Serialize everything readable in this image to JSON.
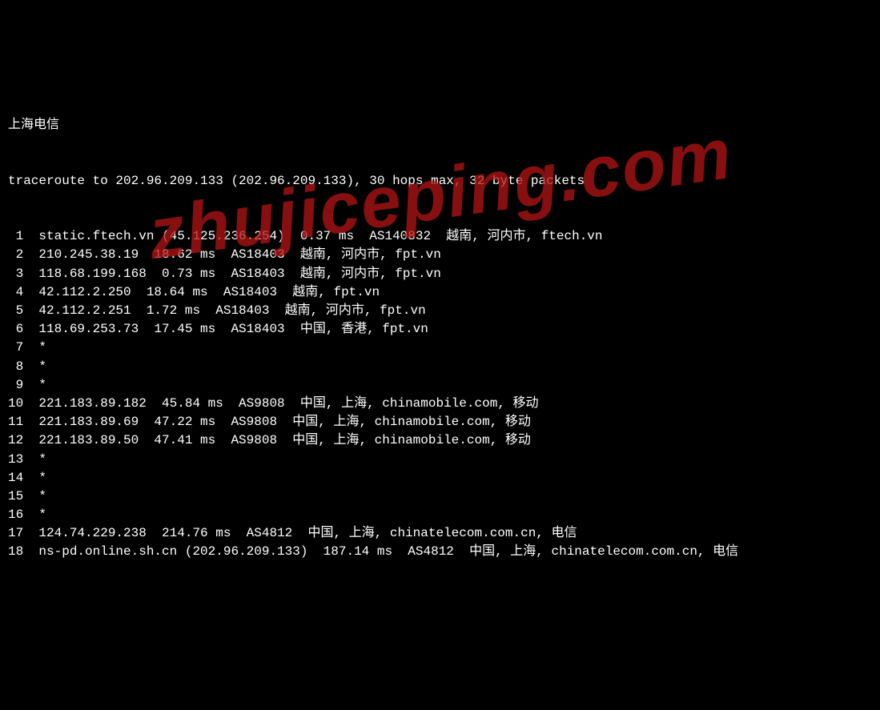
{
  "header": "上海电信",
  "command": "traceroute to 202.96.209.133 (202.96.209.133), 30 hops max, 32 byte packets",
  "watermark": "zhujiceping.com",
  "hops": [
    {
      "n": "1",
      "text": "static.ftech.vn (45.125.236.254)  0.37 ms  AS140832  越南, 河内市, ftech.vn"
    },
    {
      "n": "2",
      "text": "210.245.38.19  18.62 ms  AS18403  越南, 河内市, fpt.vn"
    },
    {
      "n": "3",
      "text": "118.68.199.168  0.73 ms  AS18403  越南, 河内市, fpt.vn"
    },
    {
      "n": "4",
      "text": "42.112.2.250  18.64 ms  AS18403  越南, fpt.vn"
    },
    {
      "n": "5",
      "text": "42.112.2.251  1.72 ms  AS18403  越南, 河内市, fpt.vn"
    },
    {
      "n": "6",
      "text": "118.69.253.73  17.45 ms  AS18403  中国, 香港, fpt.vn"
    },
    {
      "n": "7",
      "text": "*"
    },
    {
      "n": "8",
      "text": "*"
    },
    {
      "n": "9",
      "text": "*"
    },
    {
      "n": "10",
      "text": "221.183.89.182  45.84 ms  AS9808  中国, 上海, chinamobile.com, 移动"
    },
    {
      "n": "11",
      "text": "221.183.89.69  47.22 ms  AS9808  中国, 上海, chinamobile.com, 移动"
    },
    {
      "n": "12",
      "text": "221.183.89.50  47.41 ms  AS9808  中国, 上海, chinamobile.com, 移动"
    },
    {
      "n": "13",
      "text": "*"
    },
    {
      "n": "14",
      "text": "*"
    },
    {
      "n": "15",
      "text": "*"
    },
    {
      "n": "16",
      "text": "*"
    },
    {
      "n": "17",
      "text": "124.74.229.238  214.76 ms  AS4812  中国, 上海, chinatelecom.com.cn, 电信"
    },
    {
      "n": "18",
      "text": "ns-pd.online.sh.cn (202.96.209.133)  187.14 ms  AS4812  中国, 上海, chinatelecom.com.cn, 电信"
    }
  ]
}
